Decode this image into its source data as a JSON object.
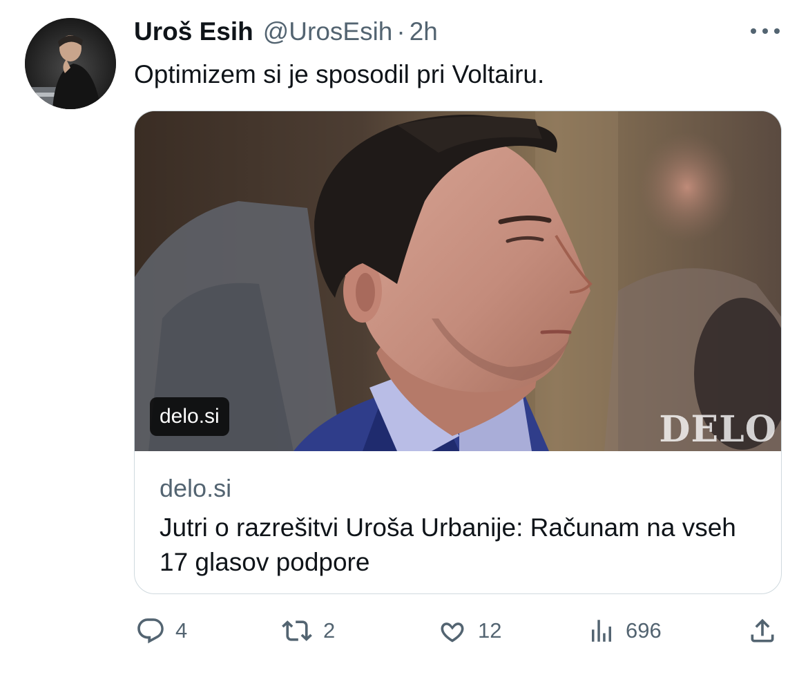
{
  "author": {
    "display_name": "Uroš Esih",
    "handle": "@UrosEsih",
    "separator": "·",
    "time": "2h"
  },
  "tweet": {
    "text": "Optimizem si je sposodil pri Voltairu."
  },
  "card": {
    "image_overlay_domain": "delo.si",
    "image_watermark": "DELO",
    "domain": "delo.si",
    "title": "Jutri o razrešitvi Uroša Urbanije: Računam na vseh 17 glasov podpore"
  },
  "actions": {
    "replies": "4",
    "reposts": "2",
    "likes": "12",
    "views": "696"
  },
  "colors": {
    "text_primary": "#0f1419",
    "text_secondary": "#536471",
    "border": "#cfd9de"
  },
  "icons": [
    "more-icon",
    "reply-icon",
    "repost-icon",
    "like-icon",
    "views-icon",
    "share-icon"
  ]
}
